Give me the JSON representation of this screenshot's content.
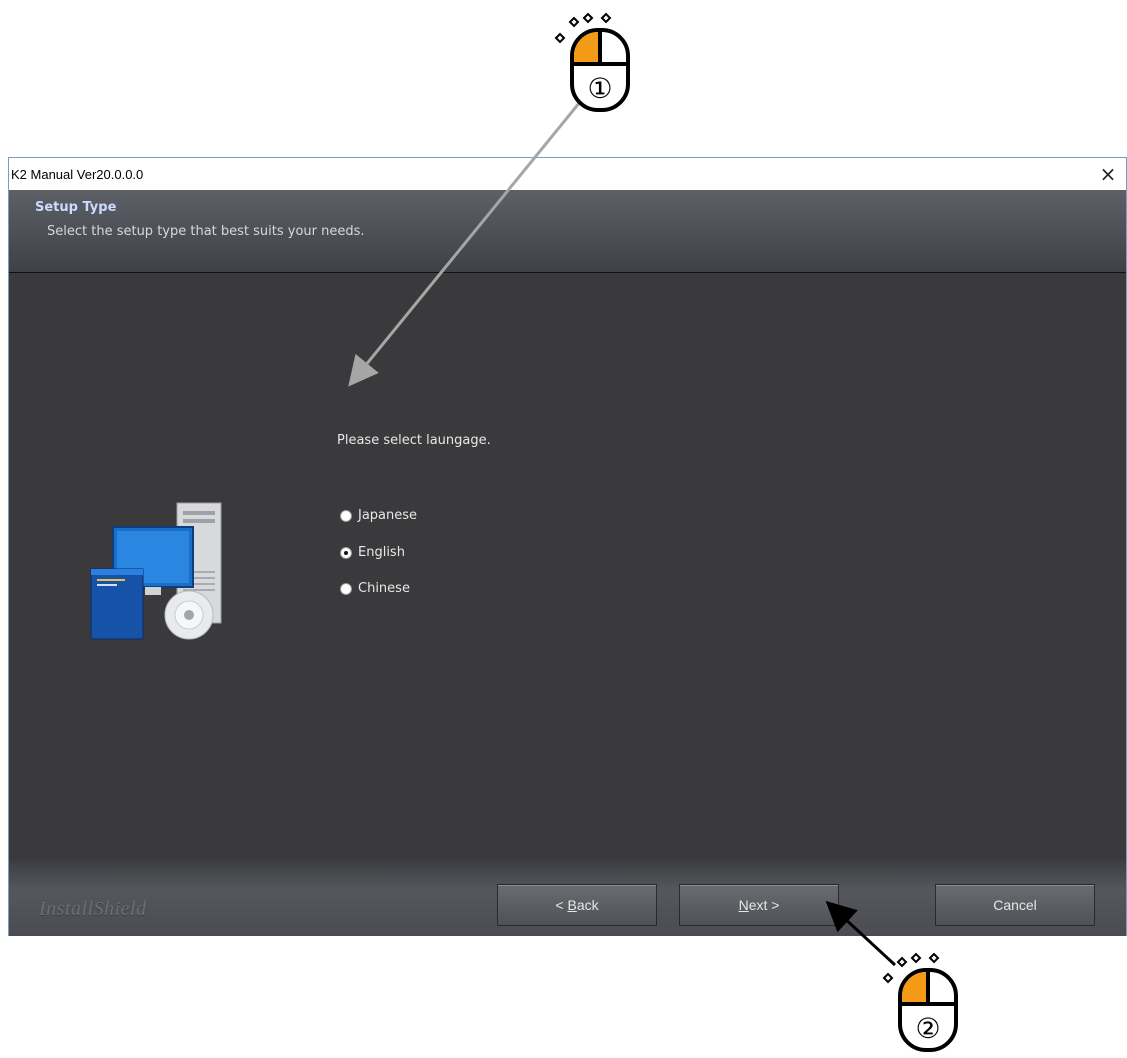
{
  "window": {
    "title": "K2 Manual Ver20.0.0.0",
    "close_glyph": "×"
  },
  "header": {
    "title": "Setup Type",
    "subtitle": "Select the setup type that best suits your needs."
  },
  "main": {
    "prompt": "Please select laungage.",
    "options": [
      {
        "label": "Japanese",
        "selected": false
      },
      {
        "label": "English",
        "selected": true
      },
      {
        "label": "Chinese",
        "selected": false
      }
    ]
  },
  "footer": {
    "brand": "InstallShield",
    "back_label": "< Back",
    "back_mnemonic": "B",
    "next_label": "Next >",
    "next_mnemonic": "N",
    "cancel_label": "Cancel"
  },
  "annotations": {
    "step1": "①",
    "step2": "②"
  },
  "colors": {
    "accent_orange": "#f39a17",
    "dialog_bg": "#3b3b3d",
    "header_title": "#c9dcff"
  }
}
